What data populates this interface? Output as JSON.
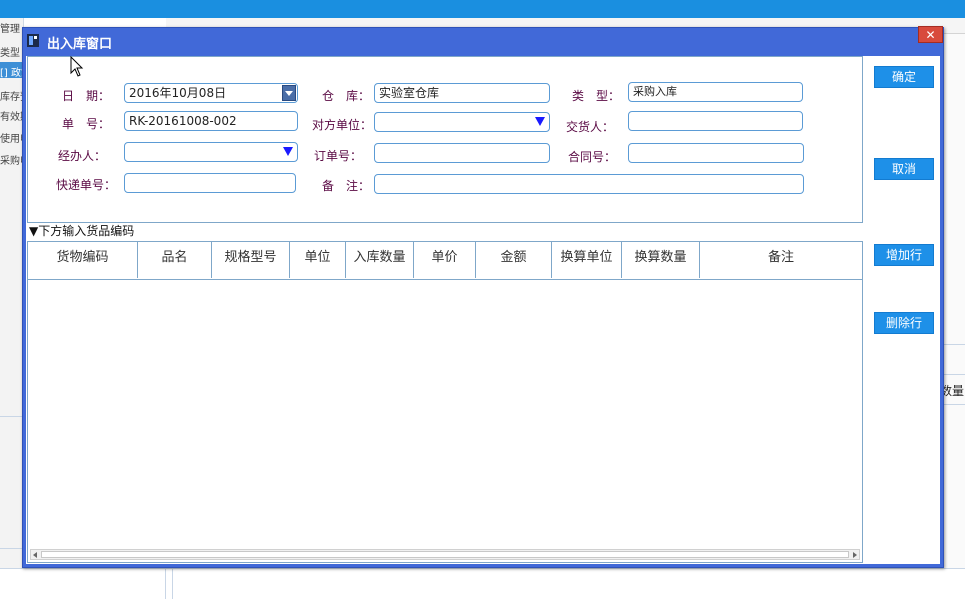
{
  "dialog": {
    "title": "出入库窗口",
    "close_label": "✕"
  },
  "form": {
    "date_label": "日　期：",
    "date_value": "2016年10月08日",
    "warehouse_label": "仓　库：",
    "warehouse_value": "实验室仓库",
    "type_label": "类　型：",
    "type_value": "采购入库",
    "number_label": "单　号：",
    "number_value": "RK-20161008-002",
    "counterparty_label": "对方单位：",
    "counterparty_value": "",
    "deliverer_label": "交货人：",
    "deliverer_value": "",
    "handler_label": "经办人：",
    "handler_value": "",
    "order_no_label": "订单号：",
    "order_no_value": "",
    "contract_no_label": "合同号：",
    "contract_no_value": "",
    "express_no_label": "快递单号：",
    "express_no_value": "",
    "remark_label": "备　注：",
    "remark_value": ""
  },
  "grid": {
    "hint": "▼下方输入货品编码",
    "columns": [
      "货物编码",
      "品名",
      "规格型号",
      "单位",
      "入库数量",
      "单价",
      "金额",
      "换算单位",
      "换算数量",
      "备注"
    ],
    "rows": []
  },
  "buttons": {
    "confirm": "确定",
    "cancel": "取消",
    "add_row": "增加行",
    "delete_row": "删除行"
  },
  "background": {
    "left_items": [
      "管理",
      "类型",
      "[] 政策",
      "库存预",
      "有效期",
      "使用申",
      "采购申"
    ],
    "right_text": "数量"
  },
  "colors": {
    "dialog_frame": "#4169d8",
    "button_bg": "#1e90e8",
    "close_bg": "#d84a3c",
    "label_text": "#5a0a44"
  }
}
